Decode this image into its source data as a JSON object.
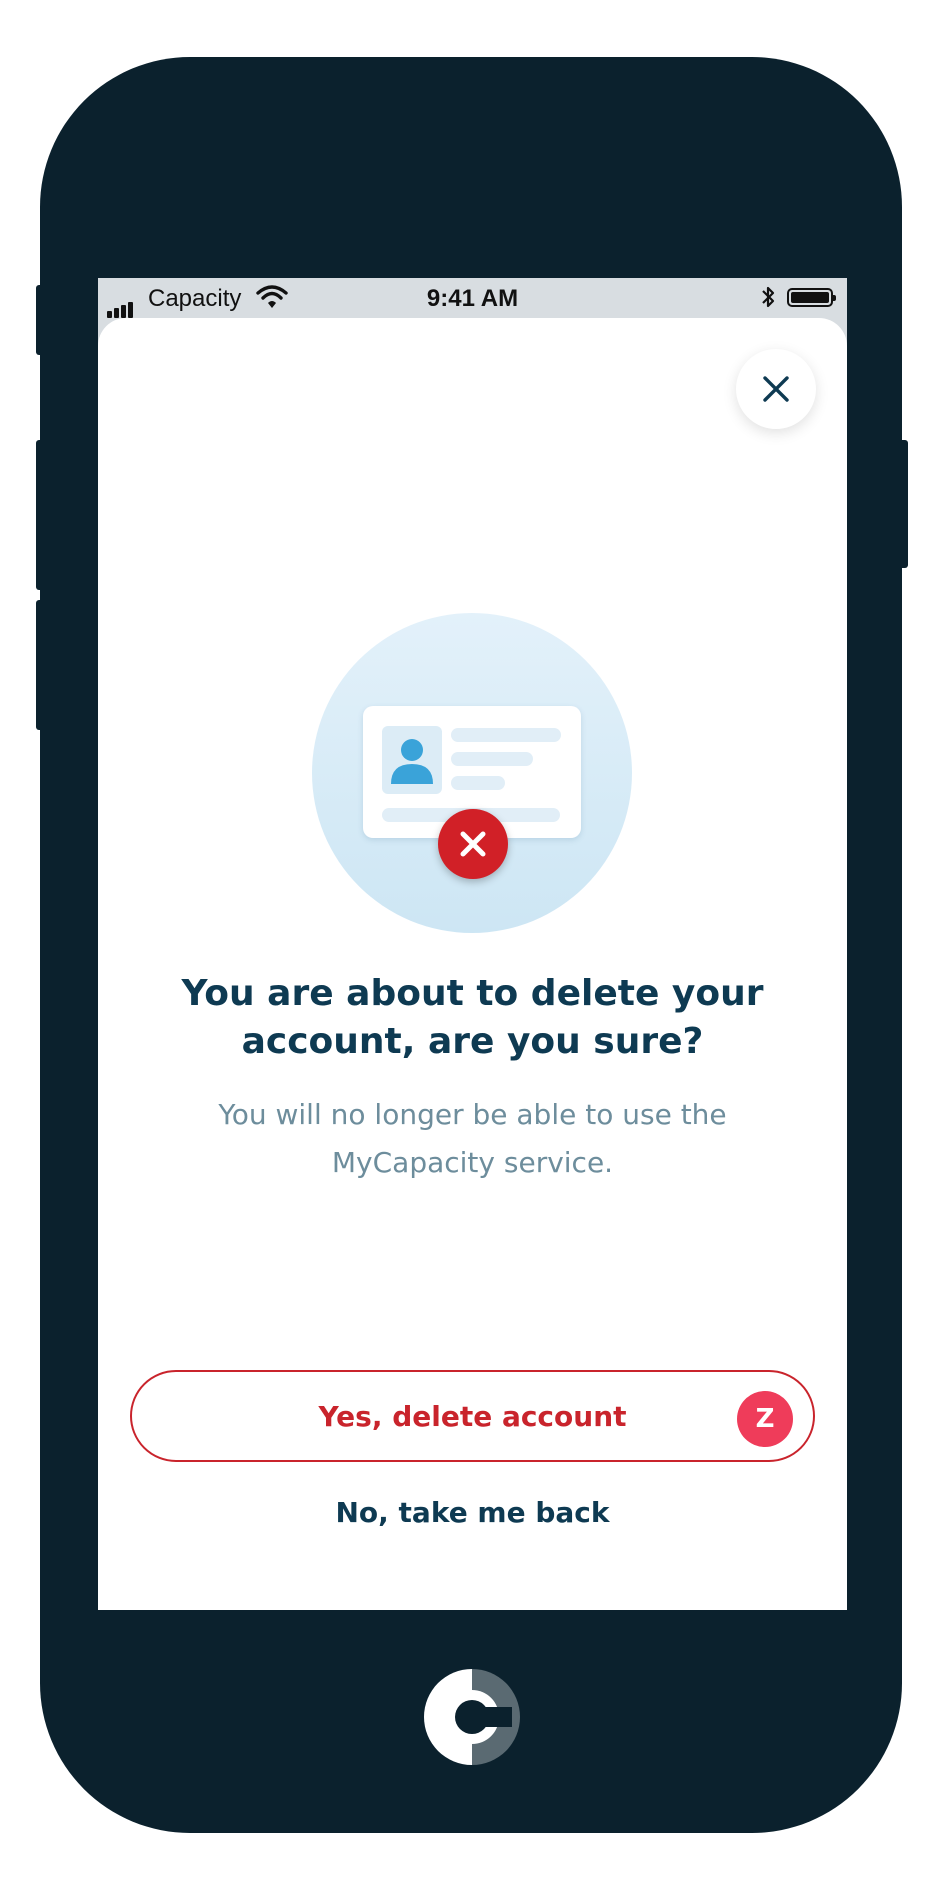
{
  "status_bar": {
    "carrier": "Capacity",
    "time": "9:41 AM",
    "icons": [
      "signal-icon",
      "wifi-icon",
      "bluetooth-icon",
      "battery-icon"
    ]
  },
  "dialog": {
    "close_icon": "close-icon",
    "illustration": "id-card-delete-icon",
    "title": "You are about to delete your account, are you sure?",
    "subtitle": "You will no longer be able to use the MyCapacity service.",
    "primary_button": {
      "label": "Yes, delete account",
      "badge": "Z"
    },
    "secondary_link": "No, take me back"
  },
  "colors": {
    "phone_frame": "#0b212d",
    "title_text": "#0e3a52",
    "body_text": "#6d8d9c",
    "danger": "#c9242c",
    "badge": "#ef3c5a"
  }
}
